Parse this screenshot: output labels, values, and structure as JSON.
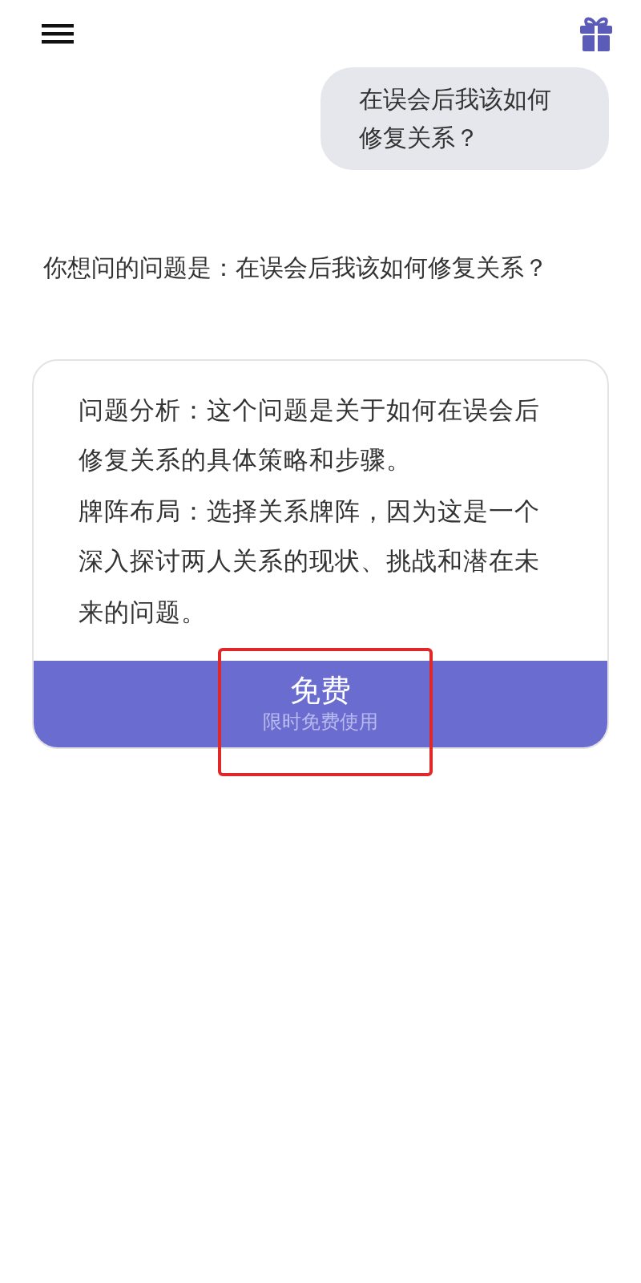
{
  "user_message": "在误会后我该如何修复关系？",
  "reply_intro": "你想问的问题是：在误会后我该如何修复关系？",
  "card": {
    "paragraphs": [
      "问题分析：这个问题是关于如何在误会后修复关系的具体策略和步骤。",
      "牌阵布局：选择关系牌阵，因为这是一个深入探讨两人关系的现状、挑战和潜在未来的问题。"
    ],
    "button": {
      "label": "免费",
      "sublabel": "限时免费使用",
      "highlighted": true
    }
  }
}
